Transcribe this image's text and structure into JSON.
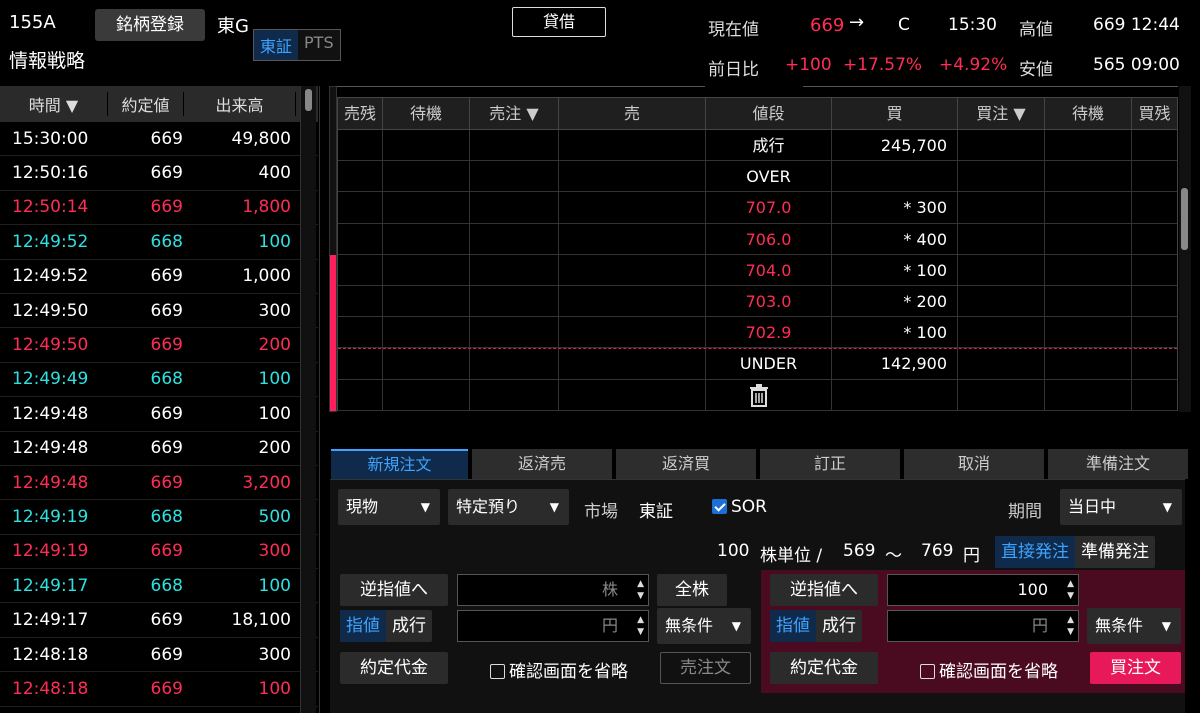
{
  "header": {
    "code": "155A",
    "register_btn": "銘柄登録",
    "market": "東G",
    "name": "情報戦略",
    "market_toggle": {
      "on": "東証",
      "off": "PTS"
    },
    "lend_btn": "貸借",
    "current_label": "現在値",
    "current_value": "669",
    "current_arrow": "→",
    "current_flag": "C",
    "current_time": "15:30",
    "high_label": "高値",
    "high_value": "669 12:44",
    "change_label": "前日比",
    "change_value": "+100",
    "change_pct": "+17.57%",
    "change_pct2": "+4.92%",
    "low_label": "安値",
    "low_value": "565 09:00"
  },
  "tape": {
    "headers": [
      "時間 ▼",
      "約定値",
      "出来高"
    ],
    "rows": [
      {
        "time": "15:30:00",
        "price": "669",
        "vol": "49,800",
        "color": "white"
      },
      {
        "time": "12:50:16",
        "price": "669",
        "vol": "400",
        "color": "white"
      },
      {
        "time": "12:50:14",
        "price": "669",
        "vol": "1,800",
        "color": "red"
      },
      {
        "time": "12:49:52",
        "price": "668",
        "vol": "100",
        "color": "cyan"
      },
      {
        "time": "12:49:52",
        "price": "669",
        "vol": "1,000",
        "color": "white"
      },
      {
        "time": "12:49:50",
        "price": "669",
        "vol": "300",
        "color": "white"
      },
      {
        "time": "12:49:50",
        "price": "669",
        "vol": "200",
        "color": "red"
      },
      {
        "time": "12:49:49",
        "price": "668",
        "vol": "100",
        "color": "cyan"
      },
      {
        "time": "12:49:48",
        "price": "669",
        "vol": "100",
        "color": "white"
      },
      {
        "time": "12:49:48",
        "price": "669",
        "vol": "200",
        "color": "white"
      },
      {
        "time": "12:49:48",
        "price": "669",
        "vol": "3,200",
        "color": "red"
      },
      {
        "time": "12:49:19",
        "price": "668",
        "vol": "500",
        "color": "cyan"
      },
      {
        "time": "12:49:19",
        "price": "669",
        "vol": "300",
        "color": "red"
      },
      {
        "time": "12:49:17",
        "price": "668",
        "vol": "100",
        "color": "cyan"
      },
      {
        "time": "12:49:17",
        "price": "669",
        "vol": "18,100",
        "color": "white"
      },
      {
        "time": "12:48:18",
        "price": "669",
        "vol": "300",
        "color": "white"
      },
      {
        "time": "12:48:18",
        "price": "669",
        "vol": "100",
        "color": "red"
      }
    ]
  },
  "book": {
    "headers": [
      "売残",
      "待機",
      "売注 ▼",
      "売",
      "値段",
      "買",
      "買注 ▼",
      "待機",
      "買残"
    ],
    "rows": [
      {
        "price": "成行",
        "buy": "245,700",
        "price_color": "white"
      },
      {
        "price": "OVER",
        "buy": "",
        "price_color": "white"
      },
      {
        "price": "707.0",
        "buy": "* 300",
        "price_color": "red"
      },
      {
        "price": "706.0",
        "buy": "* 400",
        "price_color": "red"
      },
      {
        "price": "704.0",
        "buy": "* 100",
        "price_color": "red"
      },
      {
        "price": "703.0",
        "buy": "* 200",
        "price_color": "red"
      },
      {
        "price": "702.9",
        "buy": "* 100",
        "price_color": "red"
      },
      {
        "price": "UNDER",
        "buy": "142,900",
        "price_color": "white"
      },
      {
        "price": "",
        "buy": "",
        "price_color": "white"
      }
    ],
    "trash_icon": "trash-icon"
  },
  "tabs": [
    "新規注文",
    "返済売",
    "返済買",
    "訂正",
    "取消",
    "準備注文"
  ],
  "order": {
    "account_type": "現物",
    "custody": "特定預り",
    "market_label": "市場",
    "market_value": "東証",
    "sor_label": "SOR",
    "period_label": "期間",
    "period_value": "当日中",
    "unit_qty": "100",
    "unit_label": "株単位 /",
    "range_low": "569",
    "range_sep": "〜",
    "range_high": "769",
    "range_unit": "円",
    "direct_btn": "直接発注",
    "prep_btn": "準備発注",
    "sell": {
      "stop_btn": "逆指値へ",
      "qty_placeholder": "株",
      "all_btn": "全株",
      "limit": "指値",
      "market": "成行",
      "price_placeholder": "円",
      "condition": "無条件",
      "amount_btn": "約定代金",
      "skip_confirm": "確認画面を省略",
      "submit": "売注文"
    },
    "buy": {
      "stop_btn": "逆指値へ",
      "qty_value": "100",
      "limit": "指値",
      "market": "成行",
      "price_placeholder": "円",
      "condition": "無条件",
      "amount_btn": "約定代金",
      "skip_confirm": "確認画面を省略",
      "submit": "買注文"
    }
  }
}
